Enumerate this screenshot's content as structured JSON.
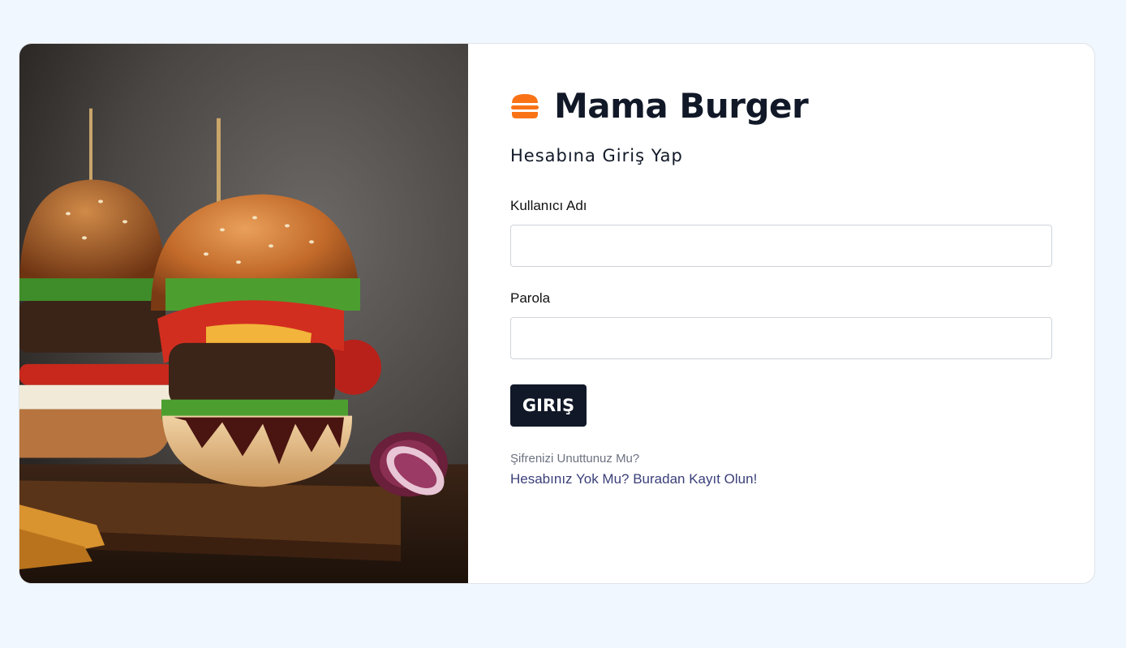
{
  "brand": {
    "name": "Mama Burger",
    "icon": "burger-icon",
    "accent_color": "#f97316"
  },
  "form": {
    "subtitle": "Hesabına Giriş Yap",
    "username_label": "Kullanıcı Adı",
    "username_value": "",
    "password_label": "Parola",
    "password_value": "",
    "submit_label": "GIRIŞ",
    "forgot_link": "Şifrenizi Unuttunuz Mu?",
    "register_link": "Hesabınız Yok Mu? Buradan Kayıt Olun!"
  },
  "image": {
    "subject": "burgers-on-wooden-board"
  },
  "colors": {
    "page_background": "#f1f7fe",
    "button_background": "#111827",
    "link_color": "#3a3f7a"
  }
}
